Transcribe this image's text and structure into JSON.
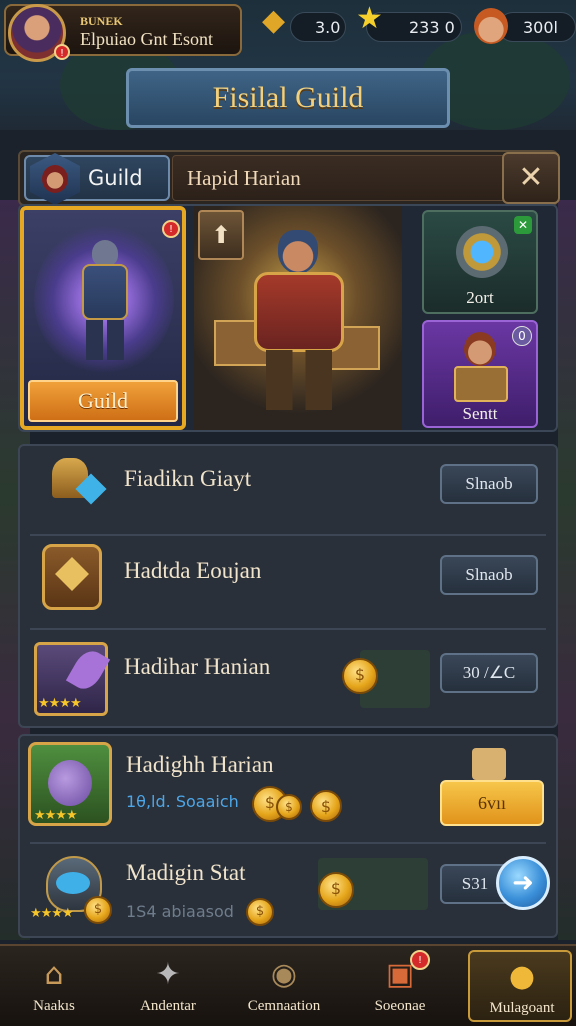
{
  "profile": {
    "line1": "BUNEK",
    "line2": "Elpuiao Gnt Esont",
    "alert": "!"
  },
  "resources": [
    {
      "icon": "gem-icon",
      "value": "3.0"
    },
    {
      "icon": "star-icon",
      "value": "233 0"
    },
    {
      "icon": "character-icon",
      "value": "300l"
    }
  ],
  "title": "Fisilal Guild",
  "guild_header": {
    "tab_label": "Guild",
    "name": "Hapid Harian",
    "close": "✕"
  },
  "hero_cards": {
    "main_card_label": "Guild",
    "upgrade": "⬆",
    "side_card_1": {
      "label": "2ort",
      "badge": "✕"
    },
    "side_card_2": {
      "label": "Sentt",
      "badge": "0"
    }
  },
  "rows": [
    {
      "title": "Fiadikn Giayt",
      "button": "Slnaob"
    },
    {
      "title": "Hadtda Eoujan",
      "button": "Slnaob"
    },
    {
      "title": "Hadihar Hanian",
      "button": "30 /∠C"
    },
    {
      "title": "Hadighh Harian",
      "subtitle": "1θ,ld. Soaaich",
      "button": "6vıı"
    },
    {
      "title": "Madigin Stat",
      "subtitle": "1Ѕ4 abiaasod",
      "button": "S31"
    }
  ],
  "nav": [
    {
      "label": "Naakıs",
      "icon": "house-icon"
    },
    {
      "label": "Andentar",
      "icon": "beast-icon"
    },
    {
      "label": "Cemnaation",
      "icon": "shield-icon"
    },
    {
      "label": "Soeonae",
      "icon": "book-icon",
      "badge": "!"
    },
    {
      "label": "Mulagoant",
      "icon": "coin-stack-icon",
      "active": true
    }
  ]
}
